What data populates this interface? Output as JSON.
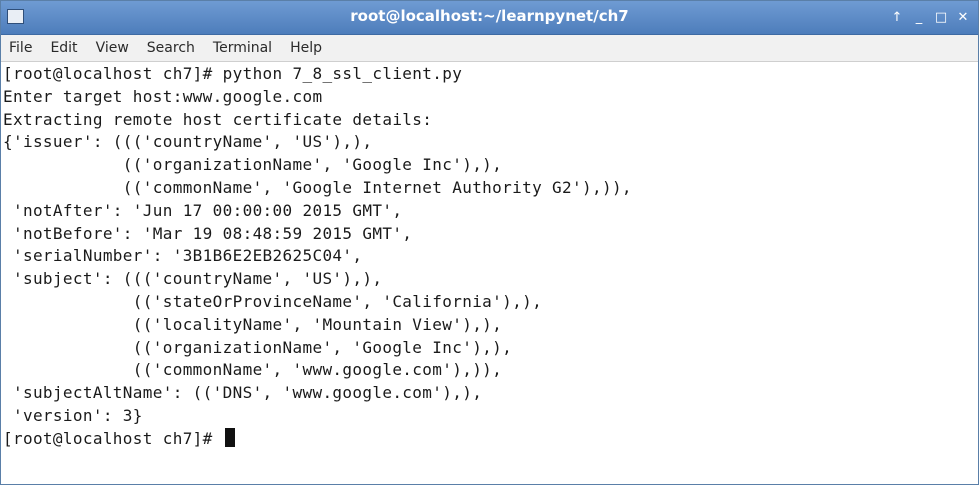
{
  "window": {
    "title": "root@localhost:~/learnpynet/ch7",
    "controls": [
      "↑",
      "_",
      "□",
      "✕"
    ]
  },
  "menubar": {
    "items": [
      "File",
      "Edit",
      "View",
      "Search",
      "Terminal",
      "Help"
    ]
  },
  "terminal": {
    "lines": [
      "[root@localhost ch7]# python 7_8_ssl_client.py",
      "Enter target host:www.google.com",
      "Extracting remote host certificate details:",
      "{'issuer': ((('countryName', 'US'),),",
      "            (('organizationName', 'Google Inc'),),",
      "            (('commonName', 'Google Internet Authority G2'),)),",
      " 'notAfter': 'Jun 17 00:00:00 2015 GMT',",
      " 'notBefore': 'Mar 19 08:48:59 2015 GMT',",
      " 'serialNumber': '3B1B6E2EB2625C04',",
      " 'subject': ((('countryName', 'US'),),",
      "             (('stateOrProvinceName', 'California'),),",
      "             (('localityName', 'Mountain View'),),",
      "             (('organizationName', 'Google Inc'),),",
      "             (('commonName', 'www.google.com'),)),",
      " 'subjectAltName': (('DNS', 'www.google.com'),),",
      " 'version': 3}"
    ],
    "prompt": "[root@localhost ch7]# "
  }
}
